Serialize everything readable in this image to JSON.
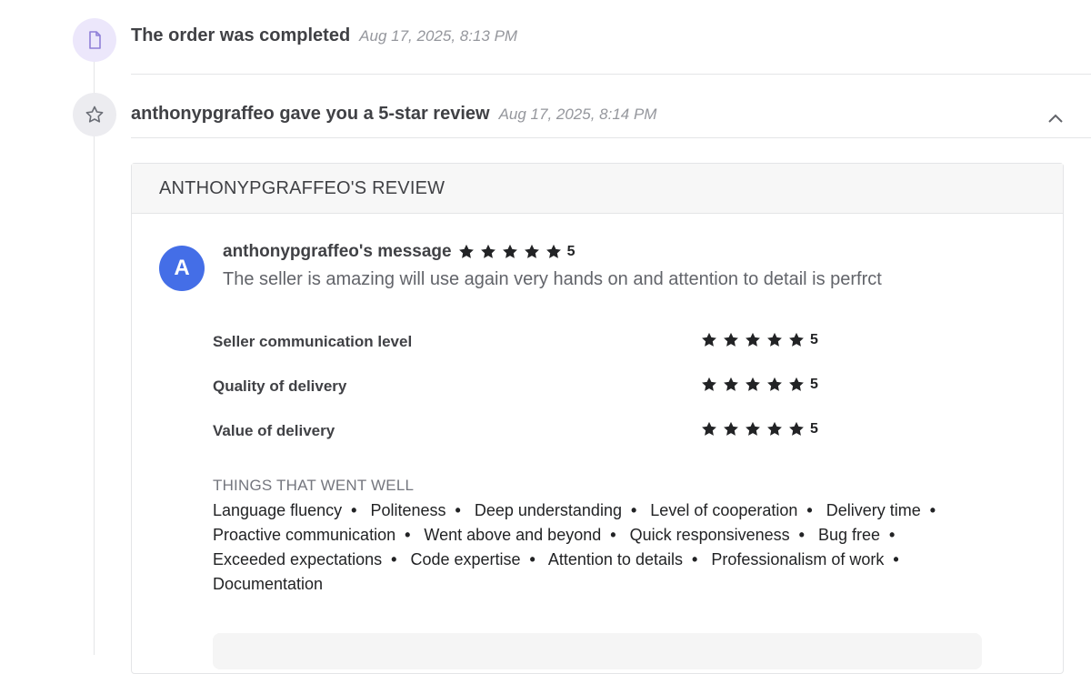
{
  "events": [
    {
      "text": "The order was completed",
      "time": "Aug 17, 2025, 8:13 PM",
      "icon": "document-icon"
    },
    {
      "text": "anthonypgraffeo gave you a 5-star review",
      "time": "Aug 17, 2025, 8:14 PM",
      "icon": "star-outline-icon"
    }
  ],
  "review": {
    "header": "ANTHONYPGRAFFEO'S REVIEW",
    "avatar_letter": "A",
    "avatar_color": "#446ee7",
    "message_title": "anthonypgraffeo's message",
    "overall_rating": "5",
    "message_text": "The seller is amazing will use again very hands on and attention to detail is perfrct",
    "criteria": [
      {
        "label": "Seller communication level",
        "rating": "5"
      },
      {
        "label": "Quality of delivery",
        "rating": "5"
      },
      {
        "label": "Value of delivery",
        "rating": "5"
      }
    ],
    "went_well_title": "THINGS THAT WENT WELL",
    "went_well_tags": [
      "Language fluency",
      "Politeness",
      "Deep understanding",
      "Level of cooperation",
      "Delivery time",
      "Proactive communication",
      "Went above and beyond",
      "Quick responsiveness",
      "Bug free",
      "Exceeded expectations",
      "Code expertise",
      "Attention to details",
      "Professionalism of work",
      "Documentation"
    ]
  },
  "colors": {
    "star": "#222325",
    "accent_purple_bg": "#ece7fb",
    "icon_purple": "#8f7fd8"
  }
}
